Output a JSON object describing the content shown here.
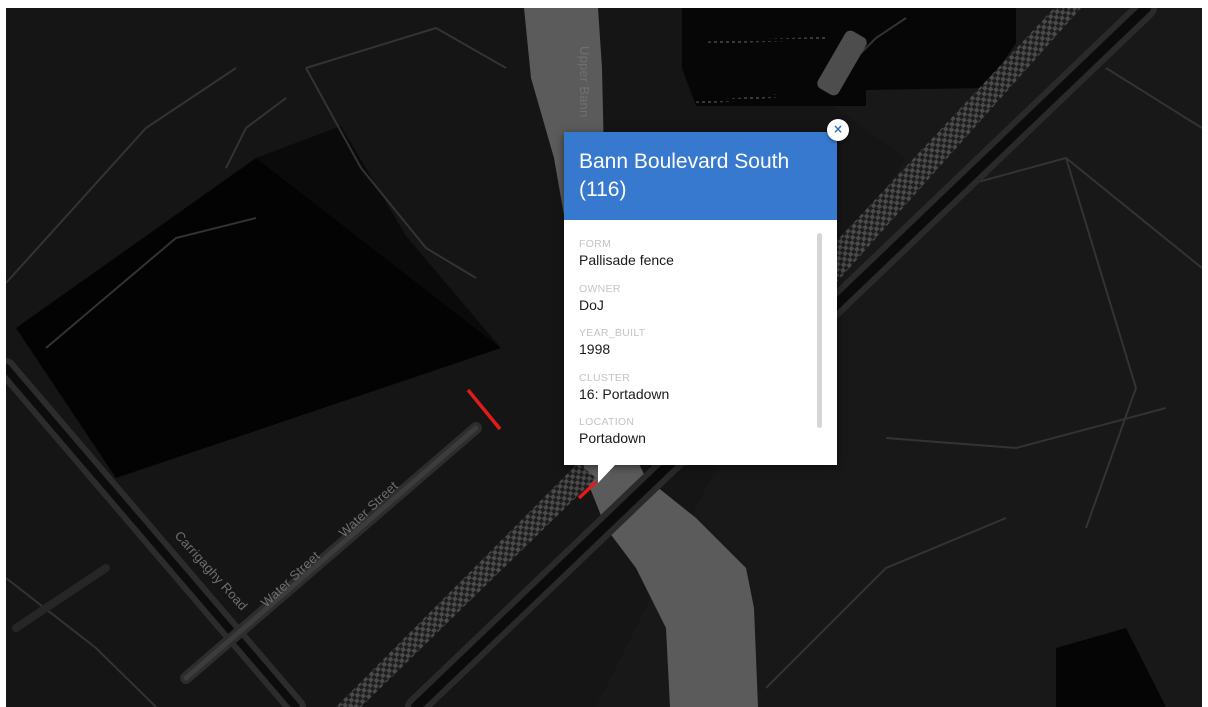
{
  "map": {
    "road_labels": {
      "upper_bann": "Upper Bann",
      "carrigaghy_road": "Carrigaghy Road",
      "water_street_1": "Water Street",
      "water_street_2": "Water Street"
    },
    "colors": {
      "background": "#141414",
      "river": "#5b5b5b",
      "building": "#000000",
      "road": "#262626",
      "feature_highlight": "#e01b1b"
    }
  },
  "popup": {
    "title": "Bann Boulevard South (116)",
    "header_color": "#3879d0",
    "close_icon": "×",
    "attributes": [
      {
        "key": "FORM",
        "value": "Pallisade fence"
      },
      {
        "key": "OWNER",
        "value": "DoJ"
      },
      {
        "key": "YEAR_BUILT",
        "value": "1998"
      },
      {
        "key": "CLUSTER",
        "value": "16: Portadown"
      },
      {
        "key": "LOCATION",
        "value": "Portadown"
      }
    ]
  }
}
